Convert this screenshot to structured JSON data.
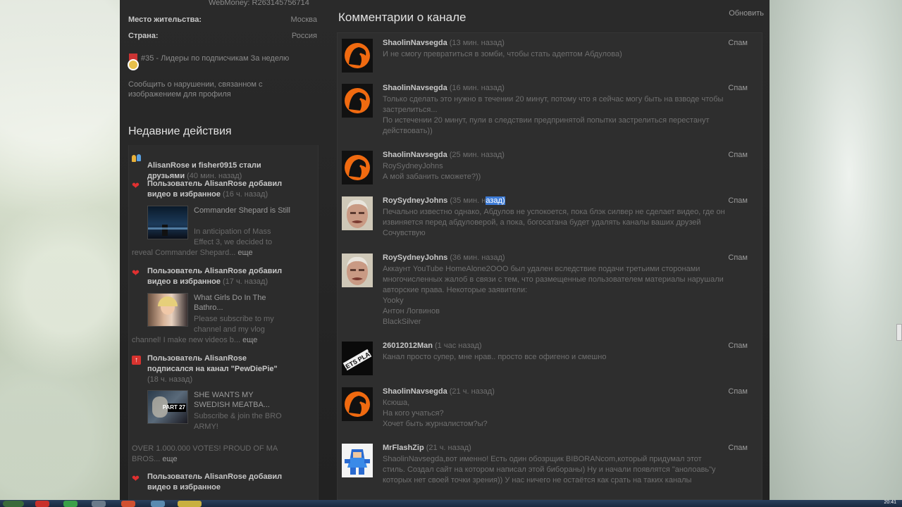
{
  "profile": {
    "webmoney": "WebMoney: R263145756714",
    "rows": [
      {
        "key": "Место жительства:",
        "value": "Москва"
      },
      {
        "key": "Страна:",
        "value": "Россия"
      }
    ],
    "rank": "#35 - Лидеры по подписчикам За неделю",
    "report_line1": "Сообщить о нарушении, связанном с",
    "report_line2": "изображением для профиля"
  },
  "recent": {
    "title": "Недавние действия",
    "items": [
      {
        "line1": "AlisanRose и fisher0915 стали",
        "line2": "друзьями",
        "ago": "(40 мин. назад)"
      },
      {
        "line1": "Пользователь AlisanRose добавил",
        "line2": "видео в избранное",
        "ago": "(16 ч. назад)",
        "video": {
          "title": "Commander Shepard is Still",
          "desc": [
            "In anticipation of Mass",
            "Effect 3, we decided to"
          ],
          "desc_last": "reveal Commander Shepard...",
          "more": "еще"
        }
      },
      {
        "line1": "Пользователь AlisanRose добавил",
        "line2": "видео в избранное",
        "ago": "(17 ч. назад)",
        "video": {
          "title": "What Girls Do In The",
          "title2": "Bathro...",
          "desc": [
            "Please subscribe to my",
            "channel and my vlog"
          ],
          "desc_last": "channel! I make new videos b...",
          "more": "еще"
        }
      },
      {
        "line1": "Пользователь AlisanRose",
        "line2": "подписался на канал",
        "channel": "PewDiePie",
        "ago": "(18 ч. назад)",
        "video": {
          "title": "SHE WANTS MY",
          "title2": "SWEDISH MEATBA...",
          "desc": [
            "Subscribe & join the BRO",
            "ARMY!"
          ],
          "desc_extra": "OVER 1.000.000 VOTES! PROUD OF MA",
          "desc_last": "BROS...",
          "more": "еще",
          "thumb_text": "PART 27"
        }
      },
      {
        "line1": "Пользователь AlisanRose добавил",
        "line2": "видео в избранное"
      }
    ]
  },
  "comments": {
    "title": "Комментарии о канале",
    "refresh": "Обновить",
    "spam_label": "Спам",
    "items": [
      {
        "author": "ShaolinNavsegda",
        "time": "(13 мин. назад)",
        "lines": [
          "И не смогу превратиться в зомби, чтобы стать адептом Абдулова)"
        ]
      },
      {
        "author": "ShaolinNavsegda",
        "time": "(16 мин. назад)",
        "lines": [
          "Только сделать это нужно в течении 20 минут, потому что я сейчас могу быть на взводе чтобы",
          "застрелиться...",
          "По истечении 20 минут, пули в следствии предпринятой попытки застрелиться перестанут",
          "действовать))"
        ]
      },
      {
        "author": "ShaolinNavsegda",
        "time": "(25 мин. назад)",
        "lines": [
          "RoySydneyJohns",
          "А мой забанить сможете?))"
        ]
      },
      {
        "author": "RoySydneyJohns",
        "time_a": "(35 мин. н",
        "time_hl": "азад)",
        "lines": [
          "Печально известно однако, Абдулов не успокоется, пока блэк силвер не сделает видео, где он",
          "извиняется перед абдуловерой, а пока, богосатана будет удалять каналы ваших друзей",
          "Сочувствую"
        ]
      },
      {
        "author": "RoySydneyJohns",
        "time": "(36 мин. назад)",
        "lines": [
          "Аккаунт YouTube HomeAlone2OOO был удален вследствие подачи третьими сторонами",
          "многочисленных жалоб в связи с тем, что размещенные пользователем материалы нарушали",
          "авторские права. Некоторые заявители:",
          "Yooky",
          "Антон Логвинов",
          "BlackSilver"
        ]
      },
      {
        "author": "26012012Man",
        "time": "(1 час назад)",
        "lines": [
          "Канал просто супер, мне нрав.. просто все офигено и смешно"
        ]
      },
      {
        "author": "ShaolinNavsegda",
        "time": "(21 ч. назад)",
        "lines": [
          "Ксюша,",
          "На кого учаться?",
          "Хочет быть журналистом?ы?"
        ]
      },
      {
        "author": "MrFlashZip",
        "time": "(21 ч. назад)",
        "lines": [
          "ShaolinNavsegda,вот именно! Есть один обозрщик BIBORANcom,который придумал этот",
          "стиль. Создал сайт на котором написал этой бибораны) Ну и начали появлятся \"анолоавь\"у",
          "которых нет своей точки зрения)) У нас ничего не остаётся как срать на таких каналы"
        ]
      }
    ]
  },
  "taskbar": {
    "clock": "20:41"
  },
  "colors": {
    "page_bg": "#262626",
    "highlight": "#3d7bd6",
    "heart": "#e03030",
    "subscribe": "#d8332f",
    "avatar_orange": "#f06a10"
  }
}
